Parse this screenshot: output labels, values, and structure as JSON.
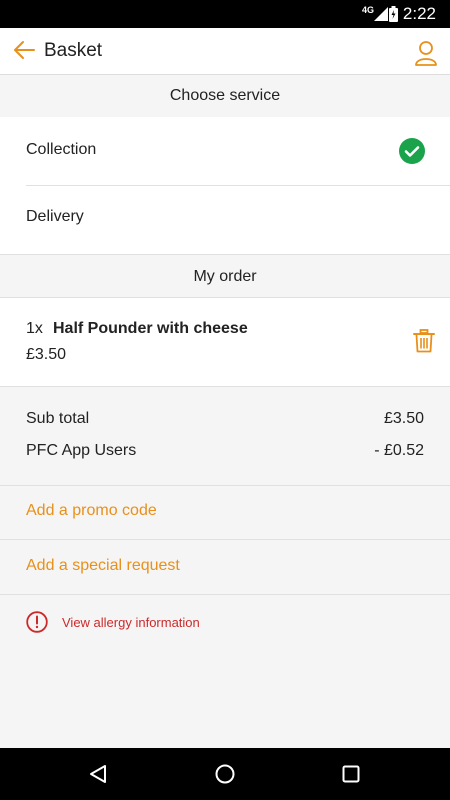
{
  "status_bar": {
    "network": "4G",
    "time": "2:22"
  },
  "app_bar": {
    "title": "Basket"
  },
  "service": {
    "header": "Choose service",
    "options": [
      {
        "label": "Collection",
        "selected": true
      },
      {
        "label": "Delivery",
        "selected": false
      }
    ]
  },
  "order": {
    "header": "My order",
    "items": [
      {
        "quantity": "1x",
        "name": "Half Pounder with cheese",
        "price": "£3.50"
      }
    ]
  },
  "totals": {
    "subtotal_label": "Sub total",
    "subtotal_value": "£3.50",
    "discount_label": "PFC App Users",
    "discount_value": "- £0.52"
  },
  "actions": {
    "promo": "Add a promo code",
    "special_request": "Add a special request",
    "allergy": "View allergy information"
  },
  "colors": {
    "accent": "#e8901a",
    "success": "#1aa34a",
    "warning": "#cc2a2a"
  }
}
